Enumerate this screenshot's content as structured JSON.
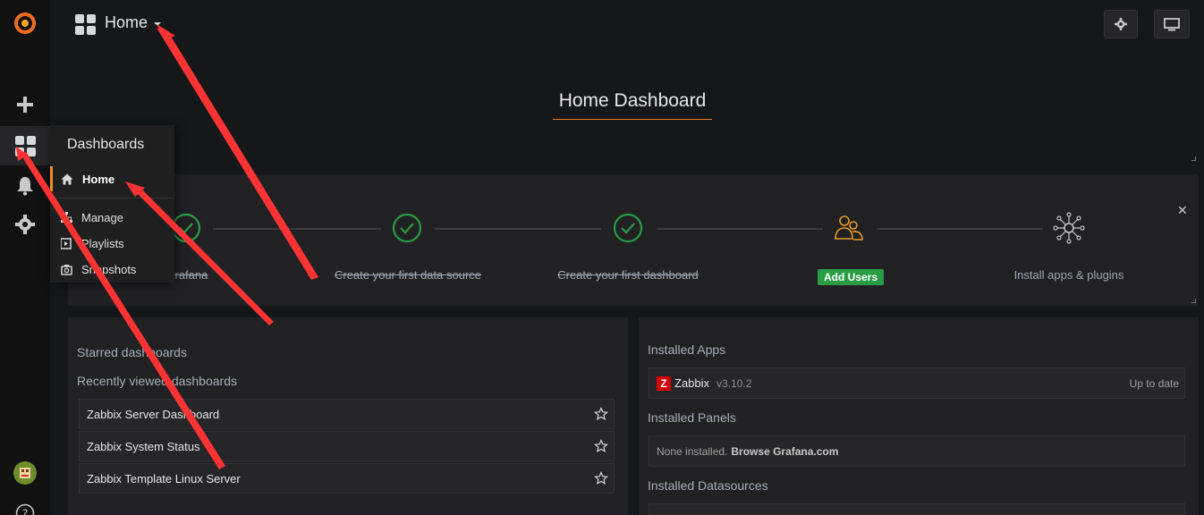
{
  "navbar": {
    "title": "Home"
  },
  "dashboard_title": "Home Dashboard",
  "flyout": {
    "title": "Dashboards",
    "home": "Home",
    "items": [
      "Manage",
      "Playlists",
      "Snapshots"
    ]
  },
  "getting_started": {
    "steps": [
      {
        "label": "Install Grafana",
        "visible_text": "ll Grafana",
        "done": true
      },
      {
        "label": "Create your first data source",
        "done": true
      },
      {
        "label": "Create your first dashboard",
        "done": true
      },
      {
        "label": "Add Users",
        "done": false
      },
      {
        "label": "Install apps & plugins",
        "done": false
      }
    ]
  },
  "dashboards": {
    "starred_title": "Starred dashboards",
    "recent_title": "Recently viewed dashboards",
    "recent": [
      "Zabbix Server Dashboard",
      "Zabbix System Status",
      "Zabbix Template Linux Server"
    ]
  },
  "plugins": {
    "apps_title": "Installed Apps",
    "app": {
      "name": "Zabbix",
      "version": "v3.10.2",
      "status": "Up to date"
    },
    "panels_title": "Installed Panels",
    "panels_none": "None installed.",
    "panels_link": "Browse Grafana.com",
    "datasources_title": "Installed Datasources"
  },
  "colors": {
    "accent": "#eb7b18",
    "success": "#299c46",
    "annotation_arrow": "#ff3333",
    "orange_users": "#e69c24"
  }
}
